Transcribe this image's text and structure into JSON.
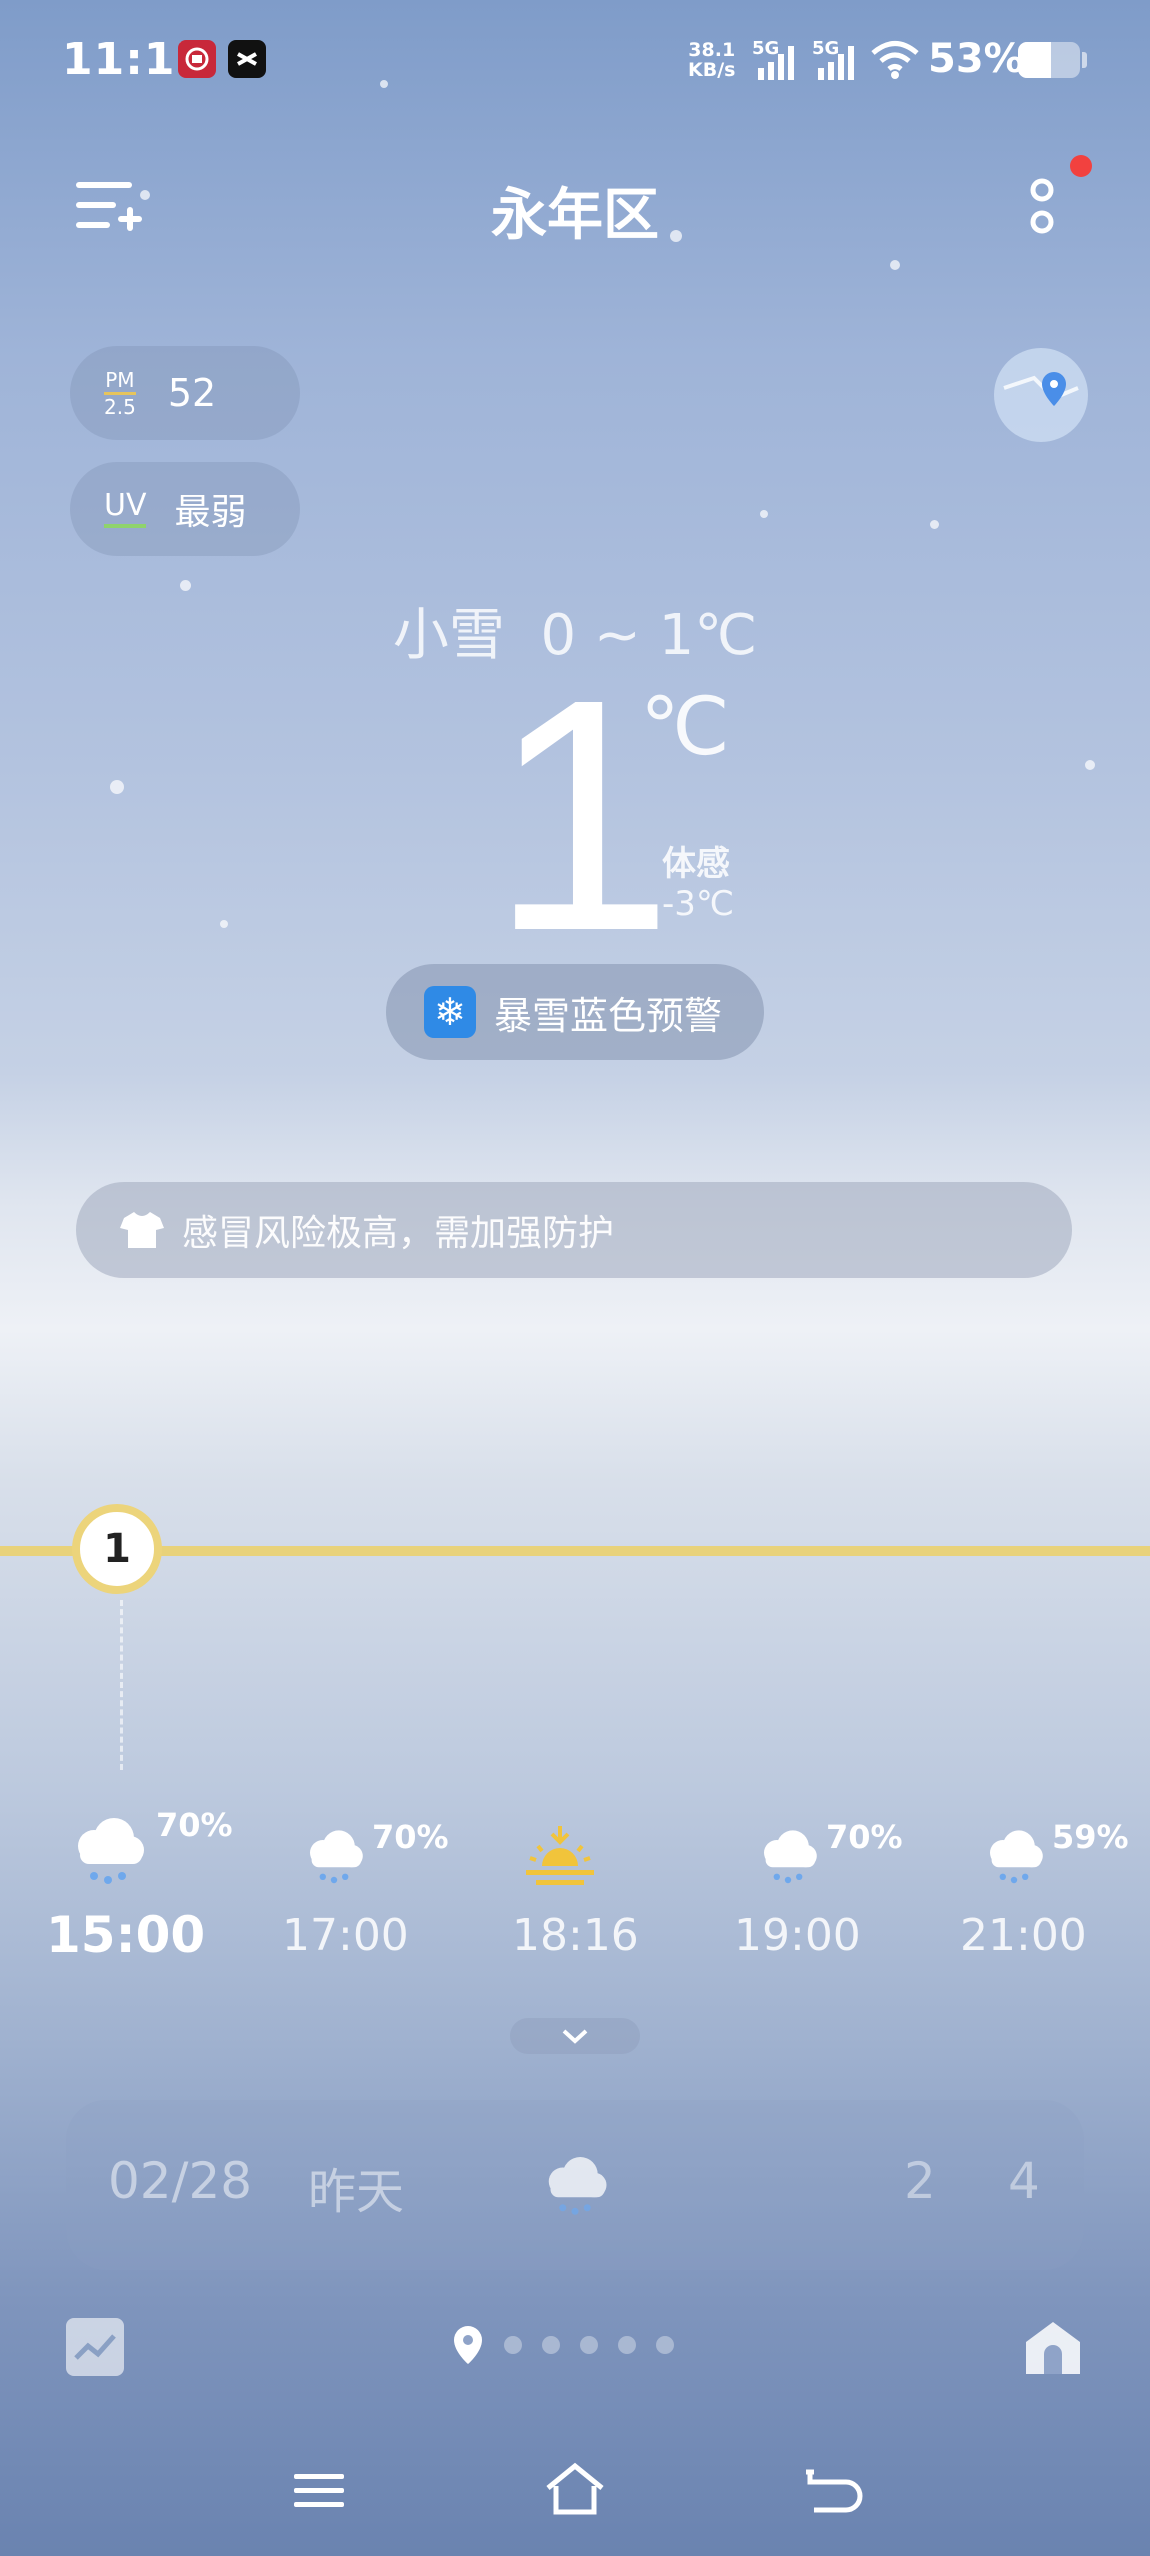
{
  "status_bar": {
    "time": "11:15",
    "net_speed_value": "38.1",
    "net_speed_unit": "KB/s",
    "sim1": "5G",
    "sim2": "5G",
    "battery": "53%",
    "battery_level": 0.53
  },
  "header": {
    "title": "永年区"
  },
  "air": {
    "pm_label_top": "PM",
    "pm_label_bottom": "2.5",
    "pm_value": "52",
    "uv_label": "UV",
    "uv_value": "最弱"
  },
  "current": {
    "condition": "小雪",
    "range": "0 ~ 1℃",
    "temp": "1",
    "unit": "℃",
    "feels_label": "体感",
    "feels_value": "-3℃"
  },
  "alert": {
    "text": "暴雪蓝色预警"
  },
  "tip": {
    "text": "感冒风险极高，需加强防护"
  },
  "temp_marker": "1",
  "hourly": [
    {
      "time": "15:00",
      "pct": "70%",
      "icon": "snow-cloud-icon"
    },
    {
      "time": "17:00",
      "pct": "70%",
      "icon": "snow-cloud-icon"
    },
    {
      "time": "18:16",
      "pct": "",
      "icon": "sunset-icon"
    },
    {
      "time": "19:00",
      "pct": "70%",
      "icon": "snow-cloud-icon"
    },
    {
      "time": "21:00",
      "pct": "59%",
      "icon": "snow-cloud-icon"
    }
  ],
  "daily": {
    "date": "02/28",
    "name": "昨天",
    "high": "2",
    "low": "4"
  },
  "colors": {
    "accent_line": "#e8d27a",
    "alert_blue": "#2f8ae6",
    "notify_red": "#f2413f"
  }
}
